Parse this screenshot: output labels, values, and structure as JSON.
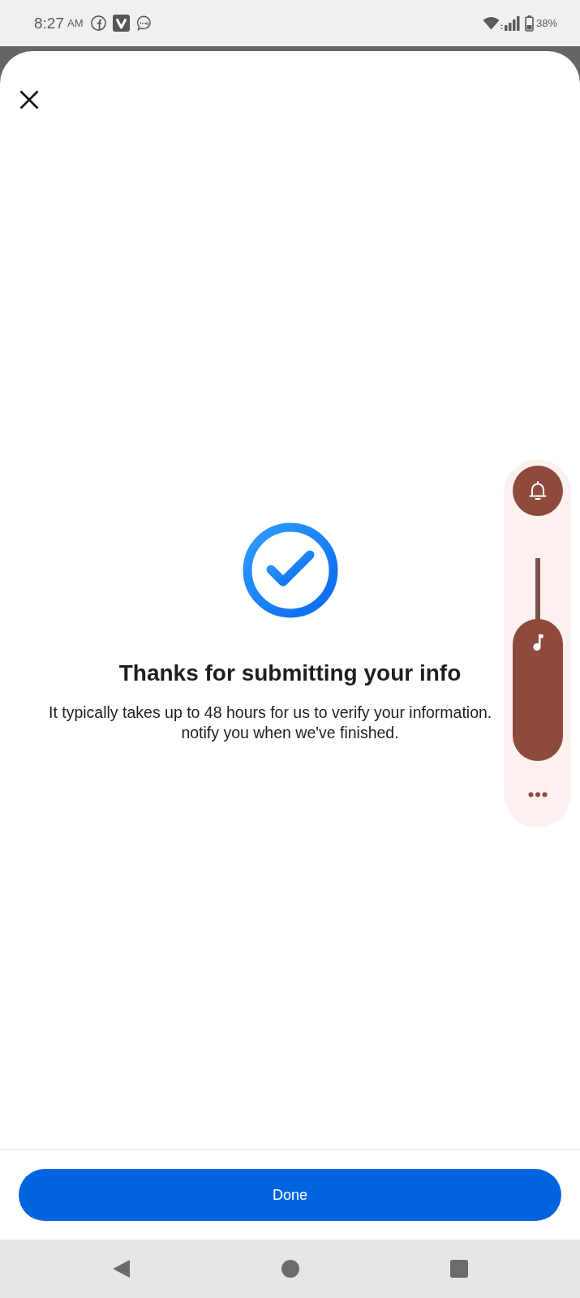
{
  "status_bar": {
    "time": "8:27",
    "meridiem": "AM",
    "battery": "38%"
  },
  "sheet": {
    "title": "Thanks for submitting your info",
    "description_lines": [
      "It typically takes up to 48 hours for us to verify your information.",
      "notify you when we've finished."
    ]
  },
  "volume_panel": {
    "level": 0.7
  },
  "footer": {
    "button": "Done"
  }
}
